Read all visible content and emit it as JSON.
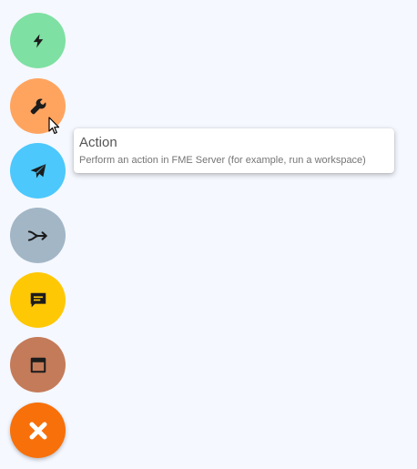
{
  "fab_menu": {
    "buttons": [
      {
        "id": "trigger",
        "icon": "lightning-bolt-icon",
        "color": "#7ee0a2"
      },
      {
        "id": "action",
        "icon": "wrench-icon",
        "color": "#ffa45f"
      },
      {
        "id": "send",
        "icon": "paper-plane-icon",
        "color": "#4cc8fc"
      },
      {
        "id": "merge",
        "icon": "merge-arrow-icon",
        "color": "#a2b6c6"
      },
      {
        "id": "message",
        "icon": "message-icon",
        "color": "#ffc805"
      },
      {
        "id": "window",
        "icon": "window-icon",
        "color": "#c47b59"
      },
      {
        "id": "close",
        "icon": "close-icon",
        "color": "#f7700a"
      }
    ]
  },
  "tooltip": {
    "title": "Action",
    "description": "Perform an action in FME Server (for example, run a workspace)"
  },
  "colors": {
    "background": "#f5f8ff",
    "icon_dark": "#1c1c1c",
    "close_icon": "#ffffff"
  }
}
